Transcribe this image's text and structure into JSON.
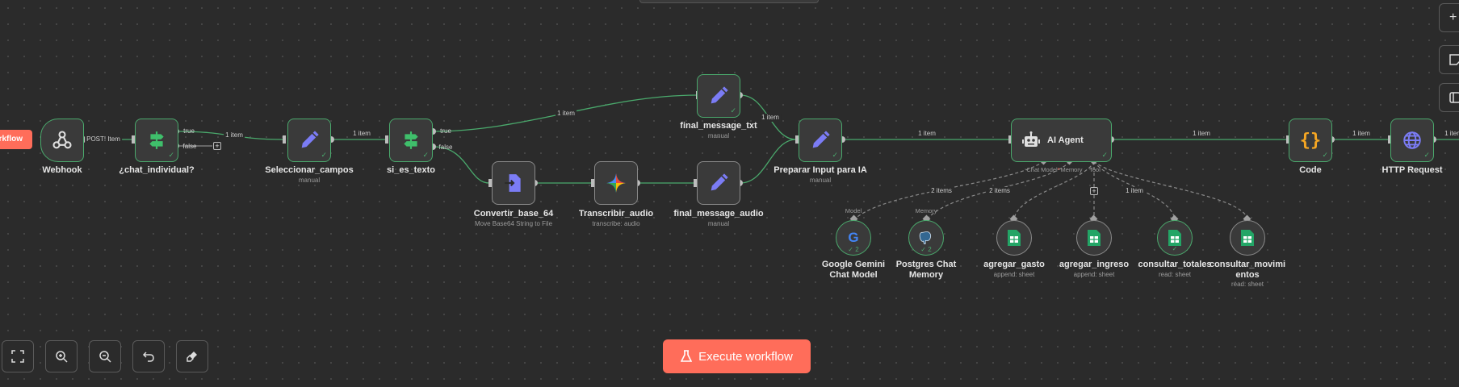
{
  "trigger_tag": "orkflow",
  "nodes": {
    "webhook": {
      "label": "Webhook"
    },
    "chat_individual": {
      "label": "¿chat_individual?"
    },
    "seleccionar_campos": {
      "label": "Seleccionar_campos",
      "sub": "manual"
    },
    "si_es_texto": {
      "label": "si_es_texto"
    },
    "final_message_txt": {
      "label": "final_message_txt",
      "sub": "manual"
    },
    "convertir_base_64": {
      "label": "Convertir_base_64",
      "sub": "Move Base64 String to File"
    },
    "transcribir_audio": {
      "label": "Transcribir_audio",
      "sub": "transcribe: audio"
    },
    "final_message_audio": {
      "label": "final_message_audio",
      "sub": "manual"
    },
    "preparar_input": {
      "label": "Preparar Input para IA",
      "sub": "manual"
    },
    "ai_agent": {
      "label": "AI Agent"
    },
    "code": {
      "label": "Code"
    },
    "http_request": {
      "label": "HTTP Request"
    },
    "gemini": {
      "label": "Google Gemini Chat Model",
      "badge": "2"
    },
    "postgres": {
      "label": "Postgres Chat Memory",
      "badge": "2"
    },
    "agregar_gasto": {
      "label": "agregar_gasto",
      "sub": "append: sheet"
    },
    "agregar_ingreso": {
      "label": "agregar_ingreso",
      "sub": "append: sheet"
    },
    "consultar_totales": {
      "label": "consultar_totales",
      "sub": "read: sheet"
    },
    "consultar_movimientos": {
      "label": "consultar_movimientos",
      "sub": "read: sheet"
    }
  },
  "edges": {
    "post_item": "POST! Item",
    "one_item": "1 item",
    "two_items": "2 items",
    "true": "true",
    "false": "false"
  },
  "ports": {
    "chat_model": "Chat Model",
    "chat_model_req": "*",
    "memory": "Memory",
    "tool": "Tool",
    "model": "Model"
  },
  "controls": {
    "execute_label": "Execute workflow"
  },
  "colors": {
    "accent": "#ff6d5a",
    "success_edge": "#4aa96c",
    "canvas": "#2b2b2b",
    "node_bg": "#3a3a3a",
    "edit_icon": "#7b7cf5",
    "switch_icon": "#3fbf6b"
  }
}
